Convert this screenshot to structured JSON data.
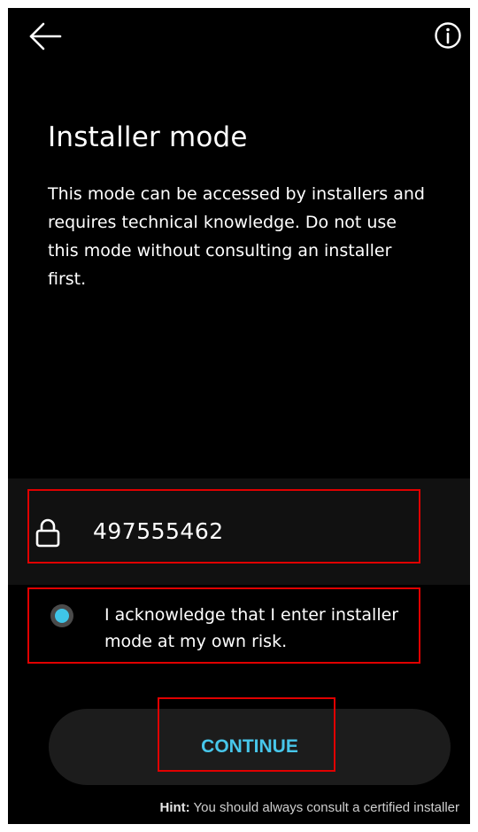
{
  "header": {
    "back_icon": "arrow-left-icon",
    "info_icon": "info-circle-icon"
  },
  "main": {
    "title": "Installer mode",
    "description": "This mode can be accessed by installers and requires technical knowledge. Do not use this mode without consulting an installer first."
  },
  "code": {
    "icon": "lock-icon",
    "value": "497555462"
  },
  "acknowledge": {
    "checked": true,
    "label": "I acknowledge that I enter installer mode at my own risk."
  },
  "actions": {
    "continue_label": "CONTINUE"
  },
  "footer": {
    "hint_label": "Hint:",
    "hint_text": "You should always consult a certified installer"
  },
  "colors": {
    "accent": "#47c6ea",
    "radio_fill": "#3fc5e8",
    "background": "#000000",
    "highlight": "#e00000"
  }
}
